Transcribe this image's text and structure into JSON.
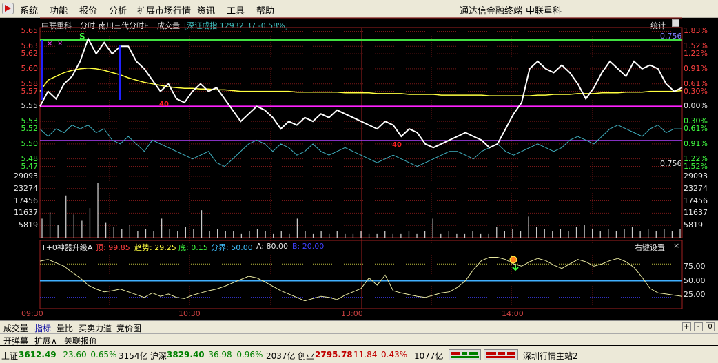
{
  "menu": {
    "items": [
      "系统",
      "功能",
      "报价",
      "分析",
      "扩展市场行情",
      "资讯",
      "工具",
      "帮助"
    ],
    "app_name": "通达信金融终端",
    "stock_name": "中联重科"
  },
  "chart_header": {
    "stock": "中联重科",
    "mode": "分时",
    "indicator": "南川三代分时E",
    "volume_label": "成交量",
    "index_label": "[深证成指 12932.37 -0.58%]",
    "stats_label": "统计",
    "ratio_top": "0.756",
    "ratio_bottom": "0.756"
  },
  "price_axis": {
    "left": [
      "5.65",
      "5.63",
      "5.62",
      "5.60",
      "5.58",
      "5.57",
      "5.55",
      "5.53",
      "5.52",
      "5.50",
      "5.48",
      "5.47"
    ],
    "right": [
      "1.83%",
      "1.52%",
      "1.22%",
      "0.91%",
      "0.61%",
      "0.30%",
      "0.00%",
      "0.30%",
      "0.61%",
      "0.91%",
      "1.22%",
      "1.52%"
    ]
  },
  "volume_axis": {
    "left": [
      "29093",
      "23274",
      "17456",
      "11637",
      "5819"
    ],
    "right": [
      "29093",
      "23274",
      "17456",
      "11637",
      "5819"
    ]
  },
  "indicator_panel": {
    "name": "T+0神器升级A",
    "top_label": "顶: 99.85",
    "trend_label": "趋势: 29.25",
    "bottom_label": "底: 0.15",
    "divide_label": "分界: 50.00",
    "a_label": "A: 80.00",
    "b_label": "B: 20.00",
    "settings": "右键设置",
    "close": "×",
    "axis": [
      "75.00",
      "50.00",
      "25.00"
    ]
  },
  "time_axis": [
    "09:30",
    "10:30",
    "13:00",
    "14:00"
  ],
  "markers": {
    "buy": "S",
    "b1": "40",
    "b2": "40"
  },
  "tabs": [
    "成交量",
    "指标",
    "量比",
    "买卖力道",
    "竞价图"
  ],
  "tabs_controls": [
    "+",
    "-",
    "0"
  ],
  "tabs2": [
    "开弹幕",
    "扩展∧",
    "关联报价"
  ],
  "status": {
    "sh_name": "上证",
    "sh_value": "3612.49",
    "sh_change": "-23.60",
    "sh_pct": "-0.65%",
    "sh_amount": "3154亿",
    "hs_name": "沪深",
    "hs_value": "3829.40",
    "hs_change": "-36.98",
    "hs_pct": "-0.96%",
    "hs_amount": "2037亿",
    "cy_name": "创业",
    "cy_value": "2795.78",
    "cy_change": "11.84",
    "cy_pct": "0.43%",
    "cy_amount": "1077亿",
    "server": "深圳行情主站2"
  },
  "chart_data": {
    "type": "line",
    "title": "中联重科 分时",
    "ylim": [
      5.465,
      5.655
    ],
    "prev_close": 5.55,
    "series": [
      {
        "name": "price",
        "color": "#ffffff",
        "values": [
          5.55,
          5.57,
          5.56,
          5.58,
          5.59,
          5.61,
          5.64,
          5.62,
          5.635,
          5.62,
          5.63,
          5.63,
          5.61,
          5.6,
          5.585,
          5.57,
          5.58,
          5.56,
          5.555,
          5.57,
          5.58,
          5.57,
          5.575,
          5.56,
          5.545,
          5.53,
          5.54,
          5.55,
          5.545,
          5.535,
          5.52,
          5.53,
          5.525,
          5.535,
          5.53,
          5.54,
          5.535,
          5.545,
          5.54,
          5.535,
          5.53,
          5.525,
          5.52,
          5.53,
          5.525,
          5.51,
          5.52,
          5.515,
          5.5,
          5.495,
          5.5,
          5.505,
          5.51,
          5.515,
          5.51,
          5.505,
          5.495,
          5.5,
          5.52,
          5.54,
          5.555,
          5.6,
          5.61,
          5.6,
          5.595,
          5.605,
          5.595,
          5.58,
          5.56,
          5.575,
          5.595,
          5.61,
          5.6,
          5.59,
          5.61,
          5.6,
          5.605,
          5.6,
          5.58,
          5.57,
          5.575
        ]
      },
      {
        "name": "avg",
        "color": "#ffff40",
        "values": [
          5.57,
          5.585,
          5.59,
          5.595,
          5.598,
          5.6,
          5.601,
          5.6,
          5.598,
          5.595,
          5.592,
          5.588,
          5.585,
          5.582,
          5.58,
          5.578,
          5.576,
          5.575,
          5.574,
          5.574,
          5.573,
          5.573,
          5.572,
          5.572,
          5.571,
          5.57,
          5.57,
          5.57,
          5.57,
          5.57,
          5.57,
          5.57,
          5.569,
          5.569,
          5.569,
          5.569,
          5.569,
          5.569,
          5.568,
          5.568,
          5.568,
          5.568,
          5.567,
          5.567,
          5.567,
          5.567,
          5.566,
          5.566,
          5.566,
          5.566,
          5.565,
          5.565,
          5.565,
          5.565,
          5.565,
          5.565,
          5.564,
          5.564,
          5.564,
          5.564,
          5.564,
          5.564,
          5.565,
          5.565,
          5.566,
          5.566,
          5.566,
          5.567,
          5.567,
          5.567,
          5.568,
          5.568,
          5.568,
          5.569,
          5.569,
          5.569,
          5.57,
          5.57,
          5.57,
          5.57,
          5.571
        ]
      }
    ],
    "index_line": [
      5.52,
      5.51,
      5.52,
      5.515,
      5.525,
      5.52,
      5.525,
      5.515,
      5.52,
      5.505,
      5.5,
      5.51,
      5.5,
      5.49,
      5.505,
      5.5,
      5.495,
      5.49,
      5.485,
      5.48,
      5.485,
      5.49,
      5.475,
      5.47,
      5.48,
      5.49,
      5.5,
      5.505,
      5.5,
      5.49,
      5.5,
      5.495,
      5.485,
      5.49,
      5.5,
      5.49,
      5.485,
      5.49,
      5.495,
      5.49,
      5.485,
      5.48,
      5.475,
      5.48,
      5.485,
      5.48,
      5.475,
      5.47,
      5.475,
      5.48,
      5.485,
      5.49,
      5.49,
      5.485,
      5.48,
      5.49,
      5.495,
      5.5,
      5.49,
      5.485,
      5.49,
      5.495,
      5.5,
      5.495,
      5.49,
      5.495,
      5.505,
      5.51,
      5.505,
      5.5,
      5.51,
      5.52,
      5.525,
      5.52,
      5.515,
      5.51,
      5.52,
      5.525,
      5.515,
      5.52,
      5.52
    ],
    "volume": {
      "ylim": [
        0,
        32000
      ],
      "values": [
        9000,
        12000,
        6000,
        20000,
        11000,
        8000,
        14000,
        26000,
        7000,
        5000,
        4000,
        6000,
        3000,
        4000,
        3000,
        9000,
        4000,
        3000,
        5000,
        4000,
        13000,
        3000,
        4000,
        3000,
        3000,
        2000,
        3000,
        4000,
        3000,
        2000,
        3000,
        2000,
        9000,
        3000,
        2000,
        3000,
        2000,
        3000,
        2000,
        2000,
        3000,
        2000,
        2000,
        3000,
        2000,
        2000,
        3000,
        2000,
        3000,
        9000,
        2000,
        3000,
        2000,
        2000,
        3000,
        2000,
        2000,
        5000,
        3000,
        4000,
        3000,
        10000,
        5000,
        4000,
        3000,
        4000,
        3000,
        5000,
        6000,
        4000,
        3000,
        4000,
        3000,
        4000,
        5000,
        3000,
        4000,
        3000,
        4000,
        3000,
        4000
      ]
    },
    "oscillator": {
      "ylim": [
        0,
        100
      ],
      "a": 80,
      "b": 20,
      "divide": 50,
      "values": [
        85,
        88,
        82,
        76,
        65,
        55,
        42,
        35,
        30,
        32,
        35,
        30,
        25,
        20,
        28,
        22,
        26,
        20,
        18,
        24,
        28,
        32,
        35,
        40,
        46,
        52,
        58,
        55,
        48,
        40,
        32,
        26,
        20,
        14,
        18,
        22,
        20,
        16,
        24,
        30,
        36,
        55,
        42,
        60,
        32,
        28,
        25,
        22,
        20,
        24,
        28,
        30,
        38,
        50,
        70,
        86,
        92,
        92,
        88,
        80,
        76,
        84,
        90,
        86,
        78,
        72,
        80,
        88,
        84,
        76,
        80,
        86,
        90,
        84,
        74,
        56,
        36,
        28,
        26,
        24,
        22
      ]
    }
  }
}
